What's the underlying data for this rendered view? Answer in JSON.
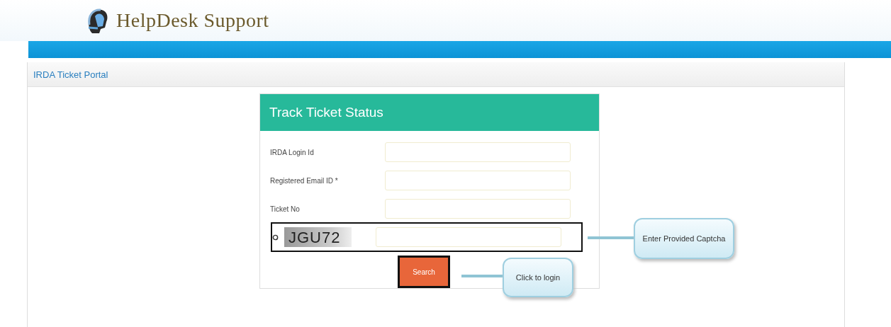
{
  "header": {
    "logo_text": "HelpDesk Support"
  },
  "breadcrumb": {
    "title": "IRDA Ticket Portal"
  },
  "form": {
    "title": "Track Ticket Status",
    "fields": [
      {
        "label": "IRDA Login Id"
      },
      {
        "label": "Registered Email ID *"
      },
      {
        "label": "Ticket No"
      }
    ],
    "captcha": {
      "code": "JGU72",
      "highlighted": true
    },
    "button": {
      "label": "Search",
      "highlighted": true
    }
  },
  "callouts": [
    {
      "text": "Enter Provided Captcha"
    },
    {
      "text": "Click to login"
    }
  ]
}
